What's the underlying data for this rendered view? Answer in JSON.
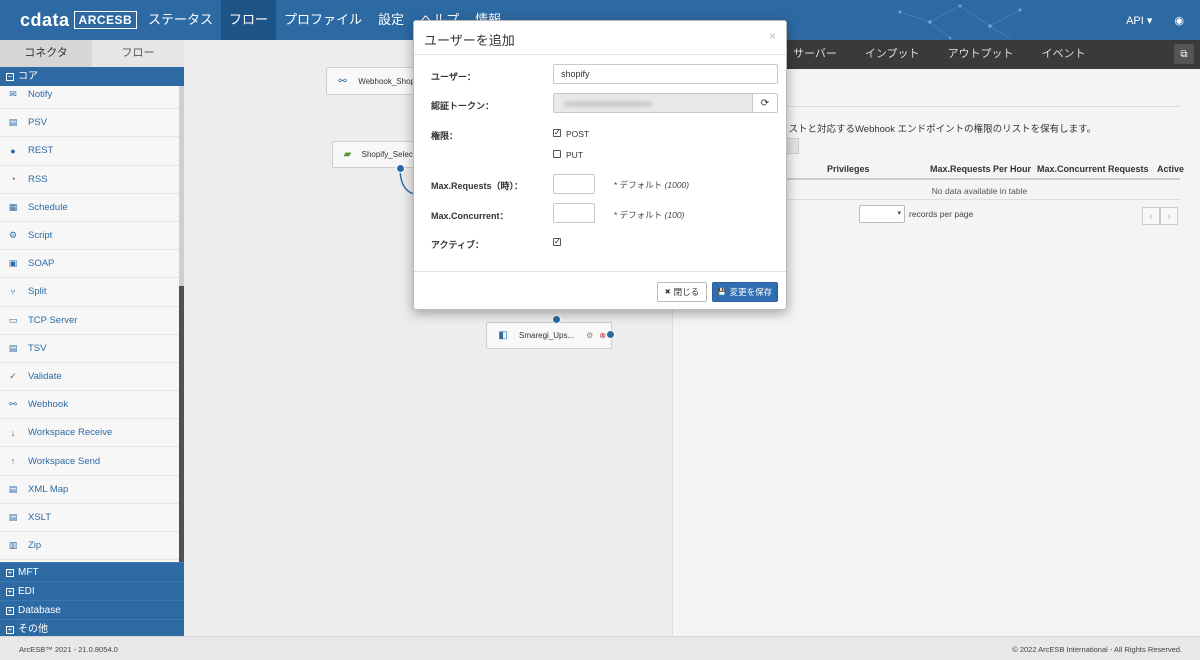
{
  "app": {
    "logo_main": "cdata",
    "logo_sub": "ARCESB",
    "nav": [
      "ステータス",
      "フロー",
      "プロファイル",
      "設定",
      "ヘルプ",
      "情報"
    ],
    "nav_active": "フロー",
    "api_label": "API ▾",
    "brand_color": "#2d6aa3"
  },
  "left": {
    "tabs": [
      "コネクタ",
      "フロー"
    ],
    "core_label": "コア",
    "core_toggle": "−",
    "items": [
      {
        "label": "Notify",
        "icon": "notify-icon",
        "glyph": "✉"
      },
      {
        "label": "PSV",
        "icon": "psv-file-icon",
        "glyph": "▤"
      },
      {
        "label": "REST",
        "icon": "rest-globe-icon",
        "glyph": "●"
      },
      {
        "label": "RSS",
        "icon": "rss-icon",
        "glyph": "◔"
      },
      {
        "label": "Schedule",
        "icon": "schedule-icon",
        "glyph": "▦"
      },
      {
        "label": "Script",
        "icon": "script-icon",
        "glyph": "⚙"
      },
      {
        "label": "SOAP",
        "icon": "soap-icon",
        "glyph": "▣"
      },
      {
        "label": "Split",
        "icon": "split-icon",
        "glyph": "⑂"
      },
      {
        "label": "TCP Server",
        "icon": "tcp-server-icon",
        "glyph": "▭"
      },
      {
        "label": "TSV",
        "icon": "tsv-file-icon",
        "glyph": "▤"
      },
      {
        "label": "Validate",
        "icon": "validate-icon",
        "glyph": "✓"
      },
      {
        "label": "Webhook",
        "icon": "webhook-icon",
        "glyph": "⚯"
      },
      {
        "label": "Workspace Receive",
        "icon": "workspace-receive-icon",
        "glyph": "↓"
      },
      {
        "label": "Workspace Send",
        "icon": "workspace-send-icon",
        "glyph": "↑"
      },
      {
        "label": "XML Map",
        "icon": "xml-map-icon",
        "glyph": "▤"
      },
      {
        "label": "XSLT",
        "icon": "xslt-icon",
        "glyph": "▤"
      },
      {
        "label": "Zip",
        "icon": "zip-icon",
        "glyph": "▥"
      }
    ],
    "categories": [
      {
        "label": "MFT",
        "toggle": "+"
      },
      {
        "label": "EDI",
        "toggle": "+"
      },
      {
        "label": "Database",
        "toggle": "+"
      },
      {
        "label": "その他",
        "toggle": "+"
      }
    ],
    "collapse_glyph": "‹"
  },
  "canvas": {
    "nodes": [
      {
        "label": "Webhook_Shop",
        "icon": "webhook-icon",
        "glyph": "⚯"
      },
      {
        "label": "Shopify_Select",
        "icon": "shopify-icon",
        "glyph": "▰"
      },
      {
        "label": "Smaregi_Ups...",
        "icon": "smaregi-icon",
        "glyph": "◧"
      }
    ]
  },
  "right": {
    "tabs": [
      "サーバー",
      "インプット",
      "アウトプット",
      "イベント"
    ],
    "ext_glyph": "⧉",
    "description": "リストと対応するWebhook エンドポイントの権限のリストを保有します。",
    "table_headers": [
      "Privileges",
      "Max.Requests Per Hour",
      "Max.Concurrent Requests",
      "Active"
    ],
    "no_data": "No data available in table",
    "per_page_label": "records per page",
    "per_page_caret": "▾",
    "pager_prev": "‹",
    "pager_next": "›"
  },
  "modal": {
    "title": "ユーザーを追加",
    "close_glyph": "×",
    "user_label": "ユーザー：",
    "user_value": "shopify",
    "token_label": "認証トークン：",
    "refresh_glyph": "⟳",
    "perm_label": "権限：",
    "perm_post": "POST",
    "perm_post_checked": true,
    "perm_put": "PUT",
    "perm_put_checked": false,
    "maxreq_label": "Max.Requests（時）：",
    "maxreq_value": "",
    "maxreq_hint": "* デフォルト",
    "maxreq_default": "(1000)",
    "maxcon_label": "Max.Concurrent：",
    "maxcon_value": "",
    "maxcon_hint": "* デフォルト",
    "maxcon_default": "(100)",
    "active_label": "アクティブ：",
    "active_checked": true,
    "check_glyph": "✓",
    "close_btn": "閉じる",
    "close_btn_glyph": "✖",
    "save_btn": "変更を保存",
    "save_btn_glyph": "💾"
  },
  "footer": {
    "version": "ArcESB™ 2021 - 21.0.8054.0",
    "copyright": "© 2022 ArcESB International - All Rights Reserved."
  }
}
